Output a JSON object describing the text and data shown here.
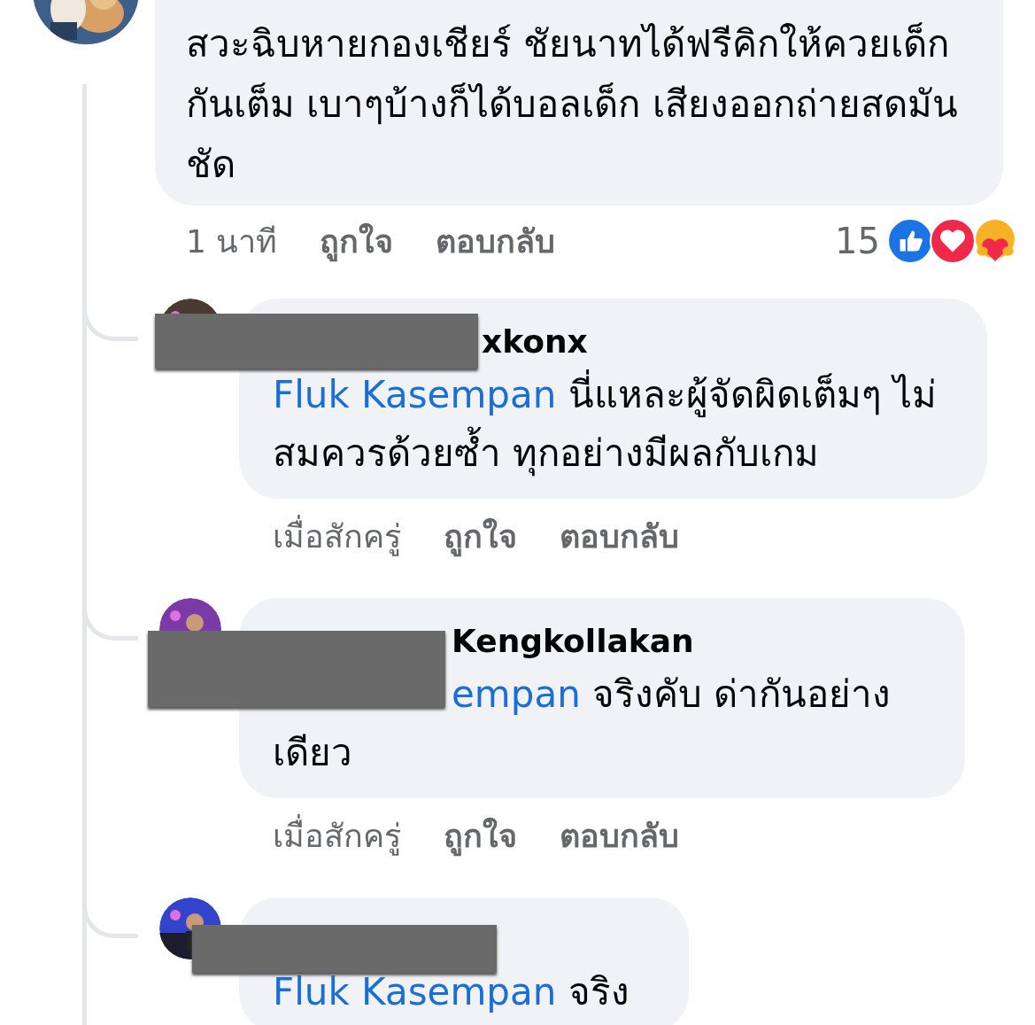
{
  "top_comment": {
    "text": "สวะฉิบหายกองเชียร์ ชัยนาทได้ฟรีคิกให้ควยเด็กกันเต็ม เบาๆบ้างก็ได้บอลเด็ก เสียงออกถ่ายสดมันชัด",
    "time": "1 นาที",
    "like": "ถูกใจ",
    "reply": "ตอบกลับ",
    "reaction_count": "15",
    "reactions": [
      {
        "kind": "like"
      },
      {
        "kind": "love"
      },
      {
        "kind": "care"
      }
    ]
  },
  "replies": [
    {
      "name": "xkonx",
      "mention": "Fluk Kasempan",
      "text": "นี่แหละผู้จัดผิดเต็มๆ ไม่สมควรด้วยซ้ำ ทุกอย่างมีผลกับเกม",
      "time": "เมื่อสักครู่",
      "like": "ถูกใจ",
      "reply": "ตอบกลับ"
    },
    {
      "name": "Kengkollakan",
      "mention": "empan",
      "text": "จริงคับ ด่ากันอย่างเดียว",
      "time": "เมื่อสักครู่",
      "like": "ถูกใจ",
      "reply": "ตอบกลับ"
    },
    {
      "mention": "Fluk Kasempan",
      "text": "จริง"
    }
  ]
}
